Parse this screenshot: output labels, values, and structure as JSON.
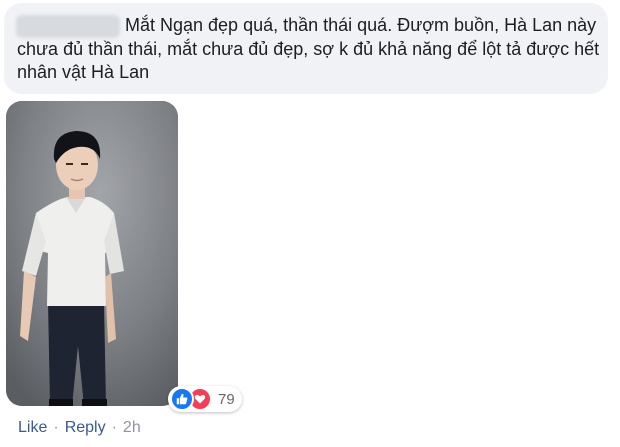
{
  "comment": {
    "author": "",
    "text": "Mắt Ngạn đẹp quá, thần thái quá. Đượm buồn, Hà Lan này chưa đủ thần thái, mắt chưa đủ đẹp, sợ k đủ khả năng để lột tả được hết nhân vật Hà Lan"
  },
  "reactions": {
    "icons": [
      "like-icon",
      "love-icon"
    ],
    "count": "79",
    "colors": {
      "like": "#1877f2",
      "love": "#f33e58"
    }
  },
  "actions": {
    "like_label": "Like",
    "reply_label": "Reply",
    "separator": "·",
    "timestamp": "2h"
  },
  "colors": {
    "link": "#385898",
    "muted": "#90949c",
    "bubble": "#f0f2f5"
  }
}
